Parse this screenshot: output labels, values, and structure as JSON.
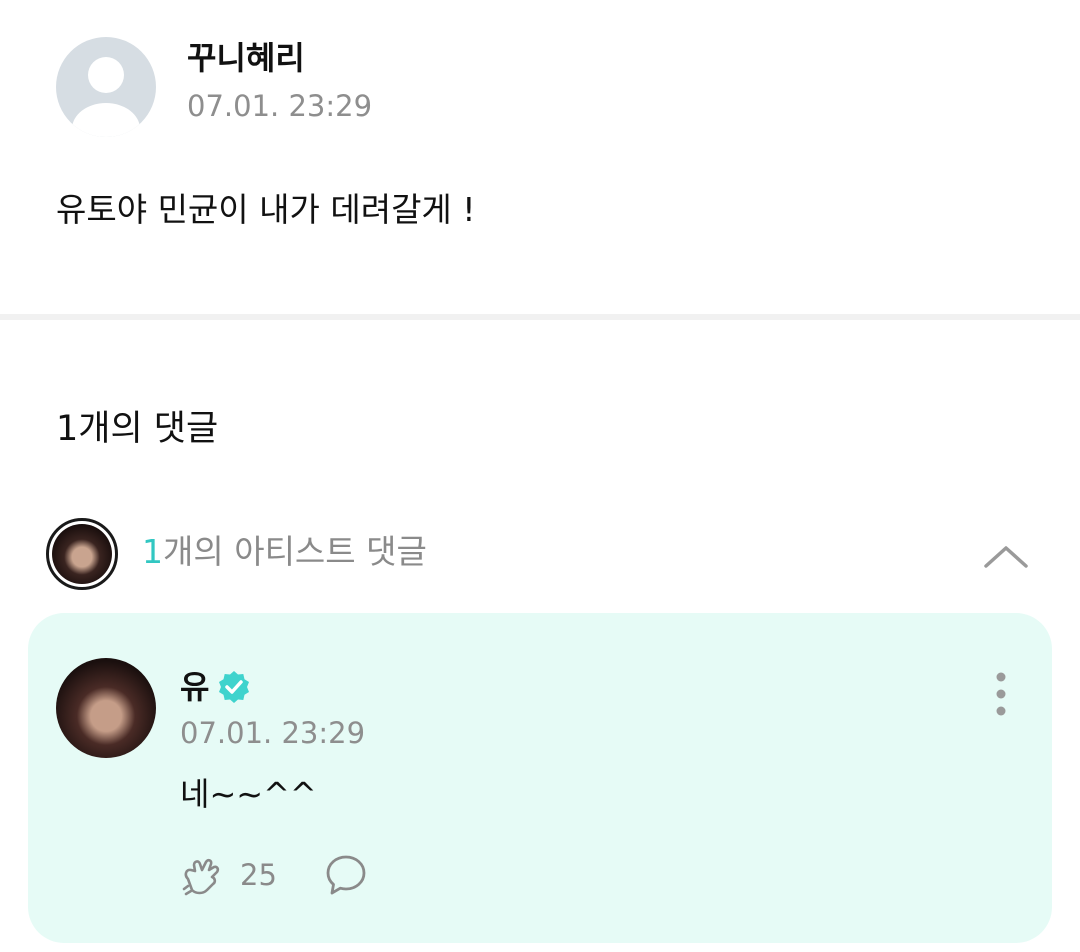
{
  "post": {
    "author": "꾸니혜리",
    "timestamp": "07.01. 23:29",
    "body": "유토야 민균이 내가 데려갈게 !",
    "avatar_icon": "default-user-avatar-icon"
  },
  "comments": {
    "count_label": "1개의 댓글"
  },
  "artist_comments": {
    "count_number": "1",
    "count_suffix": "개의 아티스트 댓글",
    "accent_color": "#32c7c2",
    "collapse_icon": "chevron-up-icon"
  },
  "comment": {
    "author": "유",
    "verified_icon": "verified-badge-icon",
    "timestamp": "07.01. 23:29",
    "body": "네~~^^",
    "like_count": "25",
    "like_icon": "like-hands-icon",
    "reply_icon": "speech-bubble-icon",
    "more_icon": "more-vertical-icon",
    "card_color": "#e6fbf6"
  }
}
